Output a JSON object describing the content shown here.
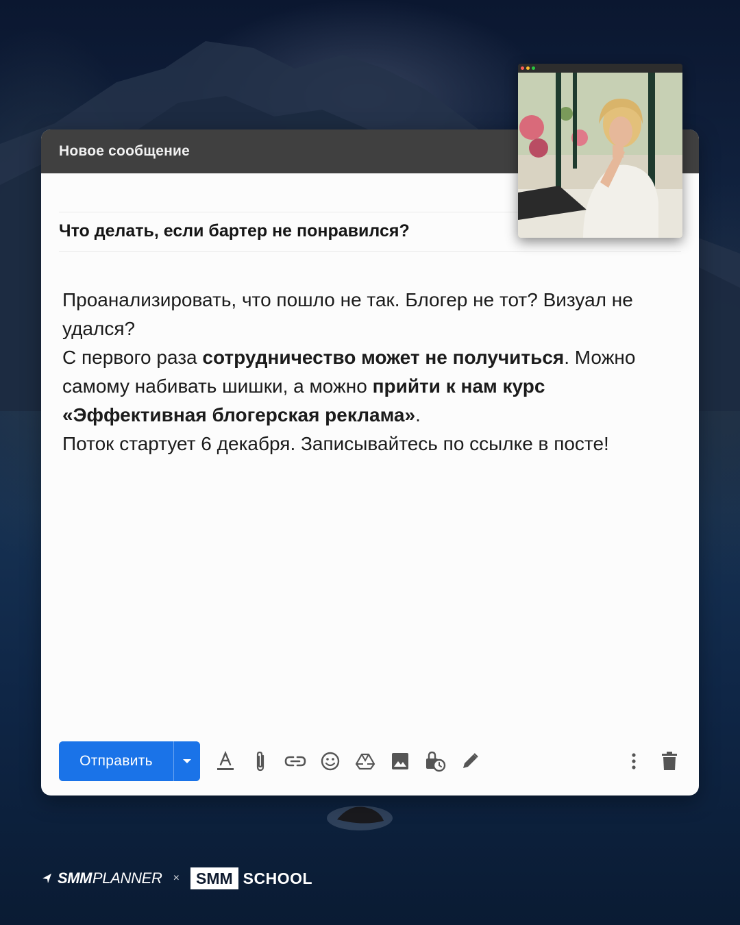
{
  "compose": {
    "header_title": "Новое сообщение",
    "subject": "Что делать, если бартер не понравился?",
    "body": {
      "p1": "Проанализировать, что пошло не так. Блогер не тот? Визуал не удался?",
      "p2_a": "С первого раза ",
      "p2_b": "сотрудничество может не получиться",
      "p2_c": ". Можно самому набивать шишки, а можно ",
      "p2_d": "прийти к нам курс «Эффективная блогерская реклама»",
      "p2_e": ".",
      "p3": "Поток стартует 6 декабря. Записывайтесь по ссылке в посте!"
    },
    "toolbar": {
      "send_label": "Отправить",
      "icons": [
        "format-text-icon",
        "attach-icon",
        "link-icon",
        "emoji-icon",
        "drive-icon",
        "image-icon",
        "lock-clock-icon",
        "signature-icon"
      ],
      "right_icons": [
        "more-options-icon",
        "trash-icon"
      ]
    },
    "colors": {
      "send": "#1a73e8",
      "header": "#404040"
    }
  },
  "footer": {
    "brand1_bold": "SMM",
    "brand1_light": "PLANNER",
    "separator": "×",
    "brand2_box": "SMM",
    "brand2_word": "SCHOOL"
  }
}
